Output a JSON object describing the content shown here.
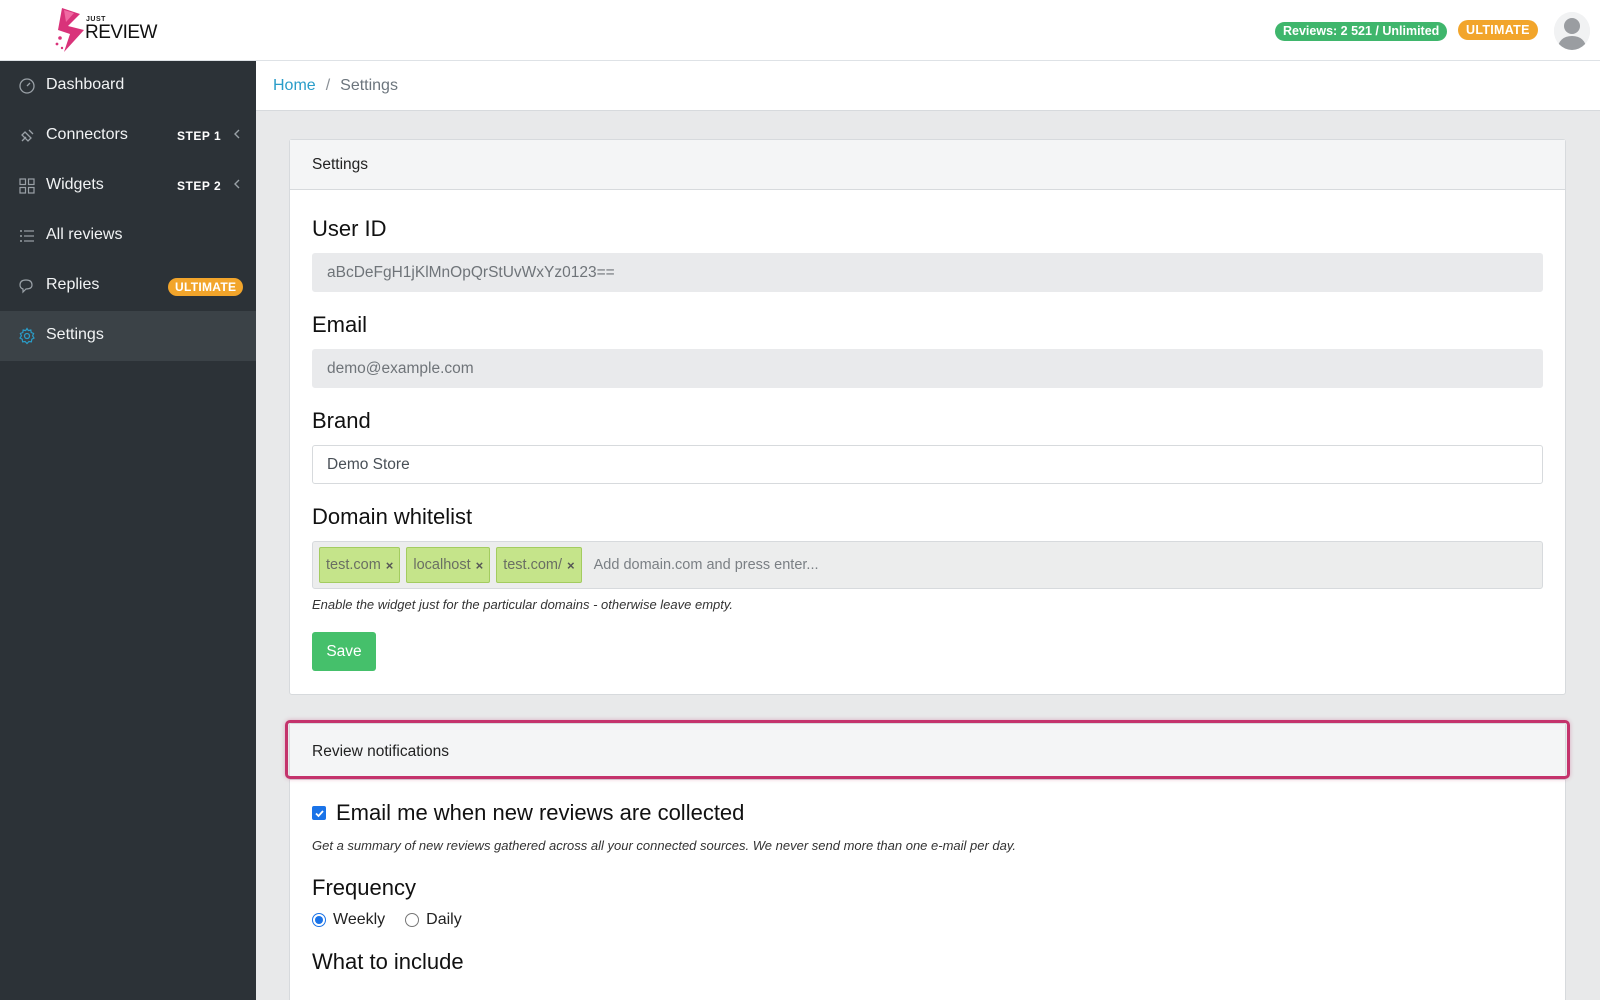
{
  "header": {
    "logo_small": "JUST",
    "logo_text": "REVIEW",
    "reviews_badge": "Reviews: 2 521 / Unlimited",
    "plan_badge": "ULTIMATE"
  },
  "sidebar": {
    "items": [
      {
        "label": "Dashboard",
        "icon": "gauge-icon"
      },
      {
        "label": "Connectors",
        "icon": "plug-icon",
        "step": "STEP 1"
      },
      {
        "label": "Widgets",
        "icon": "grid-icon",
        "step": "STEP 2"
      },
      {
        "label": "All reviews",
        "icon": "list-icon"
      },
      {
        "label": "Replies",
        "icon": "chat-icon",
        "badge": "ULTIMATE"
      },
      {
        "label": "Settings",
        "icon": "gear-icon",
        "active": true
      }
    ],
    "accent": "#2a9dc9"
  },
  "breadcrumb": {
    "home": "Home",
    "separator": "/",
    "current": "Settings"
  },
  "settings_card": {
    "title": "Settings",
    "user_id_label": "User ID",
    "user_id_value": "aBcDeFgH1jKlMnOpQrStUvWxYz0123==",
    "email_label": "Email",
    "email_value": "demo@example.com",
    "brand_label": "Brand",
    "brand_value": "Demo Store",
    "domain_label": "Domain whitelist",
    "domains": [
      "test.com",
      "localhost",
      "test.com/"
    ],
    "tag_remove": "×",
    "domain_placeholder": "Add domain.com and press enter...",
    "domain_help": "Enable the widget just for the particular domains - otherwise leave empty.",
    "save_label": "Save"
  },
  "notifications_card": {
    "title": "Review notifications",
    "email_checkbox_label": "Email me when new reviews are collected",
    "email_checked": true,
    "email_help": "Get a summary of new reviews gathered across all your connected sources. We never send more than one e-mail per day.",
    "frequency_label": "Frequency",
    "frequency_options": [
      {
        "label": "Weekly",
        "selected": true
      },
      {
        "label": "Daily",
        "selected": false
      }
    ],
    "include_label": "What to include"
  },
  "colors": {
    "sidebar_bg": "#2c3237",
    "badge_green": "#3fb66c",
    "badge_orange": "#f2a52b",
    "save_green": "#45c06b",
    "highlight": "#c4336c",
    "tag_bg": "#c5e48a"
  }
}
